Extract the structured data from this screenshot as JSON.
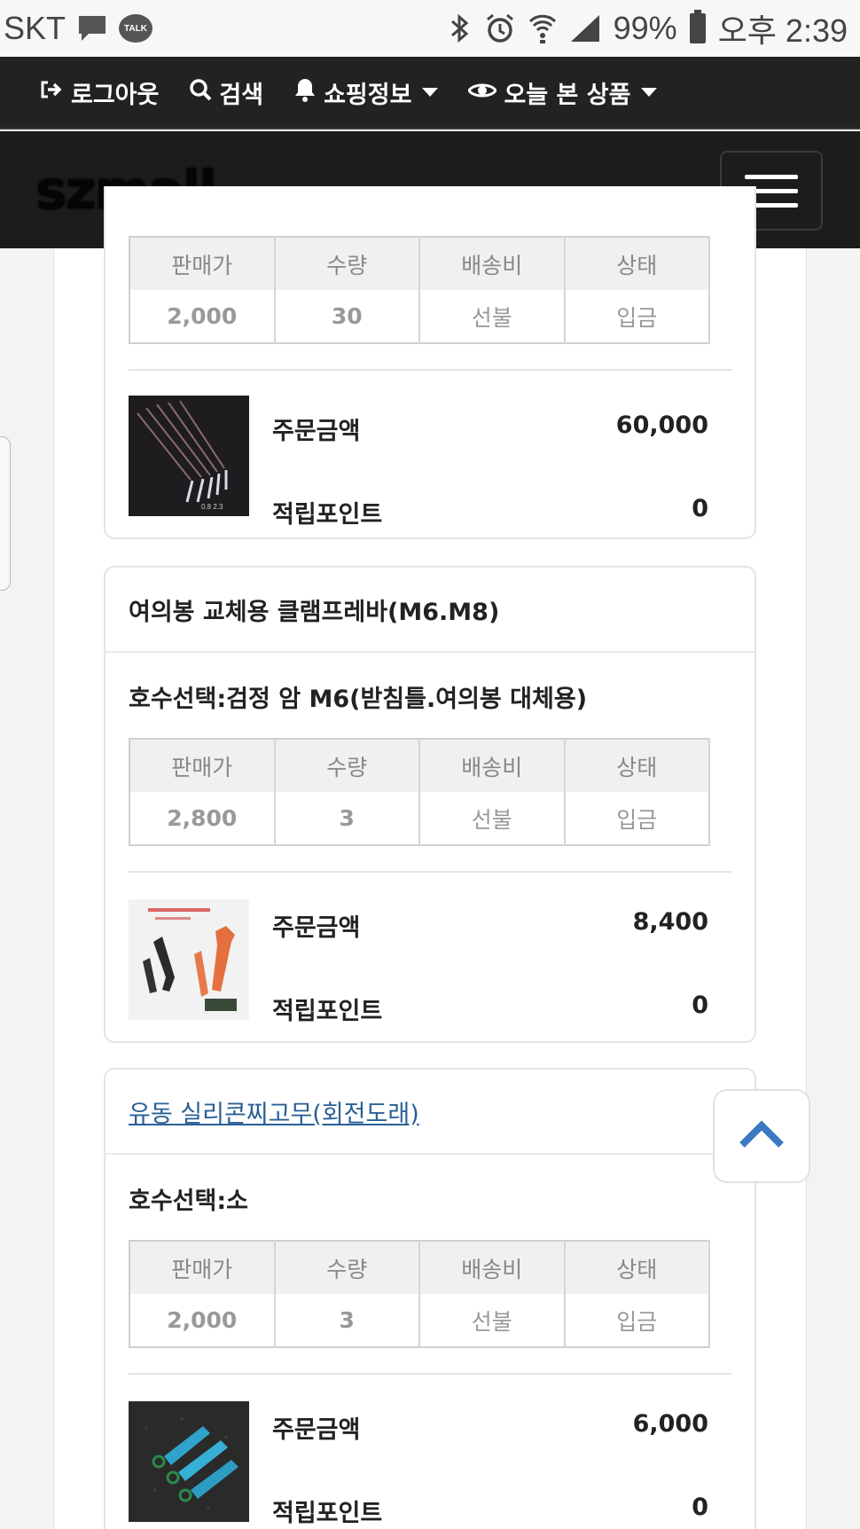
{
  "status_bar": {
    "carrier": "SKT",
    "talk_badge": "TALK",
    "battery": "99%",
    "time": "오후 2:39"
  },
  "top_nav": {
    "logout": "로그아웃",
    "search": "검색",
    "shopping_info": "쇼핑정보",
    "recently_viewed": "오늘 본 상품"
  },
  "brand": {
    "logo": "szmall"
  },
  "table_headers": {
    "price": "판매가",
    "qty": "수량",
    "shipping": "배송비",
    "status": "상태"
  },
  "summary_labels": {
    "order_amount": "주문금액",
    "points": "적립포인트"
  },
  "orders": [
    {
      "row": {
        "price": "2,000",
        "qty": "30",
        "shipping": "선불",
        "status": "입금"
      },
      "order_amount": "60,000",
      "points": "0"
    },
    {
      "title": "여의봉 교체용 클램프레바(M6.M8)",
      "option": "호수선택:검정 암 M6(받침틀.여의봉 대체용)",
      "row": {
        "price": "2,800",
        "qty": "3",
        "shipping": "선불",
        "status": "입금"
      },
      "order_amount": "8,400",
      "points": "0"
    },
    {
      "title": "유동 실리콘찌고무(회전도래)",
      "option": "호수선택:소",
      "row": {
        "price": "2,000",
        "qty": "3",
        "shipping": "선불",
        "status": "입금"
      },
      "order_amount": "6,000",
      "points": "0"
    }
  ],
  "colors": {
    "nav_bg": "#222222",
    "link": "#2a5f96",
    "accent_arrow": "#3a78c2"
  }
}
